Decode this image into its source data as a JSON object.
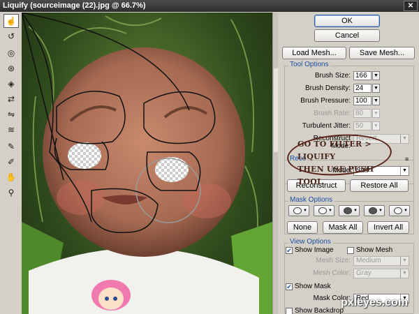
{
  "window": {
    "title": "Liquify (sourceimage (22).jpg @ 66.7%)",
    "close": "✕"
  },
  "buttons": {
    "ok": "OK",
    "cancel": "Cancel",
    "load_mesh": "Load Mesh...",
    "save_mesh": "Save Mesh..."
  },
  "tool_options": {
    "title": "Tool Options",
    "brush_size": {
      "label": "Brush Size:",
      "value": "166"
    },
    "brush_density": {
      "label": "Brush Density:",
      "value": "24"
    },
    "brush_pressure": {
      "label": "Brush Pressure:",
      "value": "100"
    },
    "brush_rate": {
      "label": "Brush Rate:",
      "value": "80"
    },
    "turbulent_jitter": {
      "label": "Turbulent Jitter:",
      "value": "50"
    },
    "reconstruct_mode": {
      "label": "Reconstruct Mode:",
      "value": "Revert"
    }
  },
  "reconstruct_options": {
    "title": "Reco",
    "mode": {
      "label": "Mode:",
      "value": "Stiff"
    },
    "reconstruct": "Reconstruct",
    "restore_all": "Restore All"
  },
  "mask_options": {
    "title": "Mask Options",
    "none": "None",
    "mask_all": "Mask All",
    "invert_all": "Invert All"
  },
  "view_options": {
    "title": "View Options",
    "show_image": "Show Image",
    "show_image_checked": true,
    "show_mesh": "Show Mesh",
    "mesh_size": {
      "label": "Mesh Size:",
      "value": "Medium"
    },
    "mesh_color": {
      "label": "Mesh Color:",
      "value": "Gray"
    },
    "show_mask": "Show Mask",
    "show_mask_checked": true,
    "mask_color": {
      "label": "Mask Color:",
      "value": "Red"
    },
    "show_backdrop": "Show Backdrop"
  },
  "annotation": {
    "line1": "GO TO FILTER > LIQUIFY",
    "line2": "THEN USE PUSH TOOL"
  },
  "watermark": "pxleyes.com",
  "tools": [
    "warp-tool-icon",
    "reconstruct-tool-icon",
    "twirl-tool-icon",
    "pucker-tool-icon",
    "bloat-tool-icon",
    "push-left-tool-icon",
    "mirror-tool-icon",
    "turbulence-tool-icon",
    "freeze-mask-tool-icon",
    "thaw-mask-tool-icon",
    "hand-tool-icon",
    "zoom-tool-icon"
  ]
}
